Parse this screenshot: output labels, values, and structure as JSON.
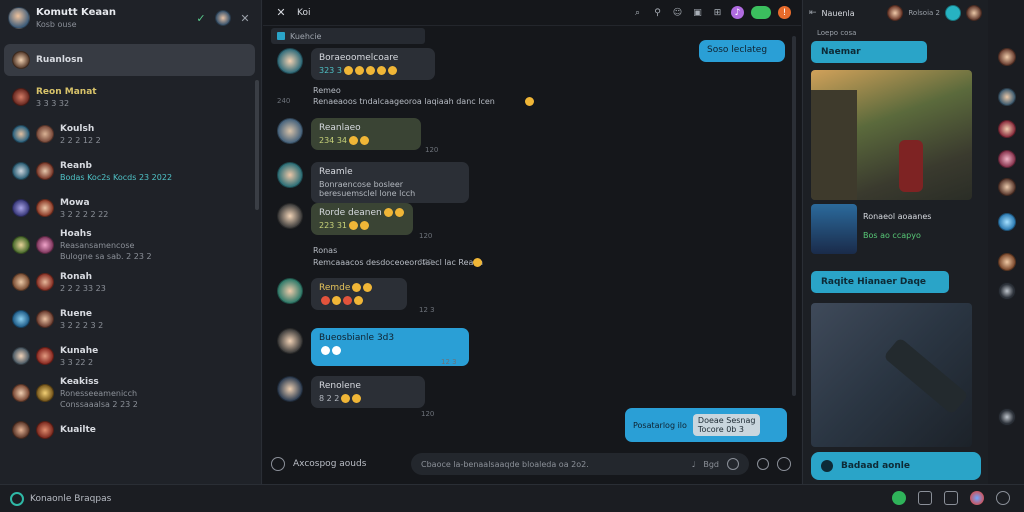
{
  "left": {
    "header": {
      "title": "Komutt Keaan",
      "subtitle": "Kosb ouse"
    },
    "contacts": [
      {
        "name": "Ruanlosn",
        "preview": "",
        "selected": true
      },
      {
        "name": "Reon Manat",
        "preview": "3 3 3 32"
      },
      {
        "name": "Koulsh",
        "preview": "2 2 2 12 2"
      },
      {
        "name": "Reanb",
        "preview": "Bodas Koc2s Kocds 23 2022"
      },
      {
        "name": "Mowa",
        "preview": "3 2 2 2 2 22"
      },
      {
        "name": "Hoahs",
        "preview": "Reasansamencose",
        "preview2": "Bulogne sa sab. 2 23 2"
      },
      {
        "name": "Ronah",
        "preview": "2 2 2 33 23"
      },
      {
        "name": "Ruene",
        "preview": "3 2 2 2 3 2"
      },
      {
        "name": "Kunahe",
        "preview": "3 3 22 2"
      },
      {
        "name": "Keakiss",
        "preview": "Ronesseeamenicch",
        "preview2": "Conssaaalsa 2 23 2"
      },
      {
        "name": "Kuailte",
        "preview": ""
      }
    ]
  },
  "bottom": {
    "app_name": "Konaonle Braqpas"
  },
  "chat": {
    "title": "Koi",
    "pinned": "Kuehcie",
    "messages": [
      {
        "name": "Boraeoomelcoare",
        "line2": "323 3"
      },
      {
        "name": "Remeo",
        "plain_line": "Renaeaoos tndalcaageoroa laqiaah danc lcen"
      },
      {
        "name": "Reanlaeo",
        "line2": "234 34"
      },
      {
        "name": "Reamle",
        "line2": "Bonraencose bosleer beresuemsclel lone lcch"
      },
      {
        "name": "Rorde deanen",
        "line2": "223 31"
      },
      {
        "name": "Ronas",
        "line2": "Remcaaacos desdoceoeorotaecl lac Reach"
      },
      {
        "name": "Remde",
        "line2": ""
      },
      {
        "name": "Bueosbianle 3d3",
        "line2": ""
      },
      {
        "name": "Renolene",
        "line2": "8 2 2"
      }
    ],
    "outgoing": [
      {
        "text": "Soso leclateg"
      },
      {
        "text": "Posatarlog ilo",
        "quote": "Doeae Sesnag",
        "quote2": "Tocore 0b 3"
      }
    ],
    "times": [
      "240",
      "120",
      "120",
      "120",
      "12 3",
      "12 3",
      "120"
    ],
    "composer": {
      "label": "Axcospog aouds",
      "placeholder": "Cbaoce la-benaalsaaqde bloaleda oa 2o2.",
      "extra": "Bgd"
    }
  },
  "right": {
    "header": {
      "title": "Nauenla",
      "sub": "Rolsoia 2"
    },
    "top_tag": "Loepo cosa",
    "top_button": "Naemar",
    "thumb_caption": "Ronaeol aoaanes",
    "thumb_caption2": "Bos ao ccapyo",
    "middle_button": "Raqite Hianaer Daqe",
    "bottom_button": "Badaad aonle"
  }
}
